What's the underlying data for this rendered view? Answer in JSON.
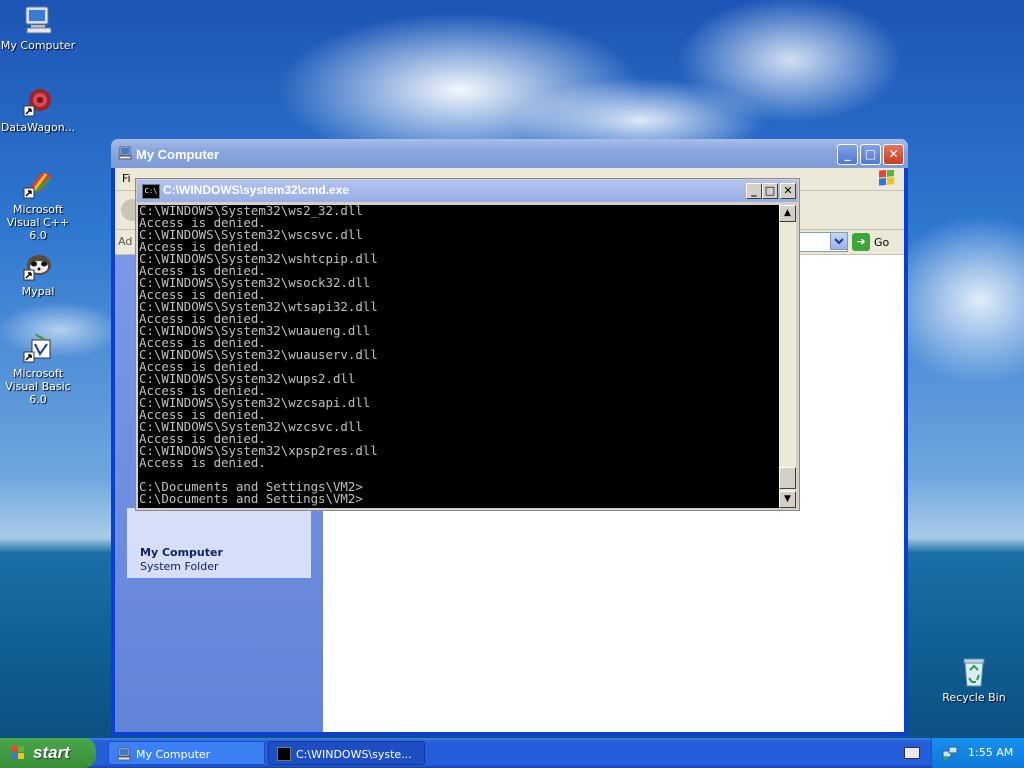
{
  "desktop": {
    "icons": [
      {
        "label": "My Computer",
        "icon": "my-computer-icon"
      },
      {
        "label": "DataWagon...",
        "icon": "datawagon-icon"
      },
      {
        "label": "Microsoft Visual C++ 6.0",
        "icon": "visual-cpp-icon"
      },
      {
        "label": "Mypal",
        "icon": "mypal-icon"
      },
      {
        "label": "Microsoft Visual Basic 6.0",
        "icon": "visual-basic-icon"
      },
      {
        "label": "Recycle Bin",
        "icon": "recycle-bin-icon"
      }
    ]
  },
  "explorer": {
    "title": "My Computer",
    "menu_partial": "Fi",
    "address_label": "Ad",
    "go_label": "Go",
    "details_title": "My Computer",
    "details_subtitle": "System Folder",
    "colors": {
      "title_active": "#0a3fd0"
    }
  },
  "cmd": {
    "title": "C:\\WINDOWS\\system32\\cmd.exe",
    "icon_text": "C:\\",
    "lines": [
      "C:\\WINDOWS\\System32\\ws2_32.dll",
      "Access is denied.",
      "C:\\WINDOWS\\System32\\wscsvc.dll",
      "Access is denied.",
      "C:\\WINDOWS\\System32\\wshtcpip.dll",
      "Access is denied.",
      "C:\\WINDOWS\\System32\\wsock32.dll",
      "Access is denied.",
      "C:\\WINDOWS\\System32\\wtsapi32.dll",
      "Access is denied.",
      "C:\\WINDOWS\\System32\\wuaueng.dll",
      "Access is denied.",
      "C:\\WINDOWS\\System32\\wuauserv.dll",
      "Access is denied.",
      "C:\\WINDOWS\\System32\\wups2.dll",
      "Access is denied.",
      "C:\\WINDOWS\\System32\\wzcsapi.dll",
      "Access is denied.",
      "C:\\WINDOWS\\System32\\wzcsvc.dll",
      "Access is denied.",
      "C:\\WINDOWS\\System32\\xpsp2res.dll",
      "Access is denied.",
      "",
      "C:\\Documents and Settings\\VM2>",
      "C:\\Documents and Settings\\VM2>"
    ]
  },
  "taskbar": {
    "start_label": "start",
    "tasks": [
      {
        "label": "My Computer",
        "icon": "my-computer-icon",
        "active": false
      },
      {
        "label": "C:\\WINDOWS\\syste...",
        "icon": "cmd-icon",
        "active": true
      }
    ],
    "clock": "1:55 AM"
  }
}
